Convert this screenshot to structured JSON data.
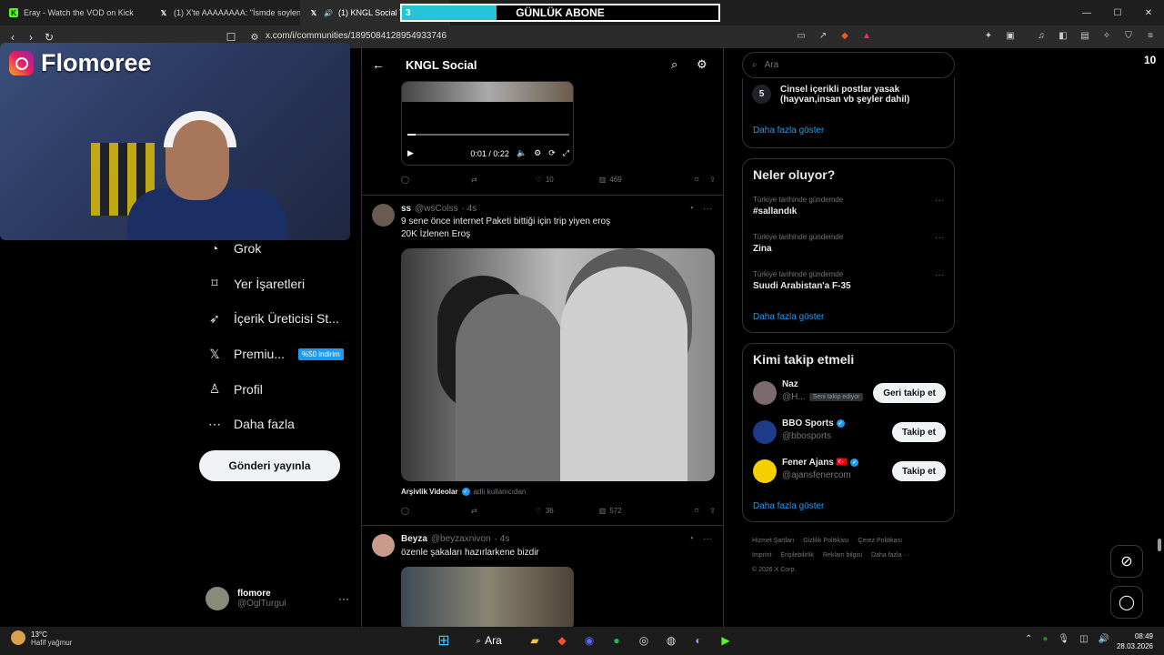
{
  "browser": {
    "tabs": [
      {
        "label": "Eray - Watch the VOD on Kick",
        "icon": "kick-icon",
        "color": "#53fc18"
      },
      {
        "label": "(1) X'te AAAAAAAA: \"İsmde soylendi",
        "icon": "x-icon",
        "color": "#ffffff"
      },
      {
        "label": "(1) KNGL Social Topluluğu",
        "icon": "x-icon",
        "color": "#ffffff"
      }
    ],
    "url": "x.com/i/communities/1895084128954933746"
  },
  "overlay": {
    "left": "3",
    "label": "GÜNLÜK ABONE",
    "right": "10",
    "progress": 0.3,
    "accent": "#25c5d6"
  },
  "webcam": {
    "brand": "Flomoree"
  },
  "left_nav": {
    "items": [
      {
        "label": "Grok",
        "icon": "grok-icon"
      },
      {
        "label": "Yer İşaretleri",
        "icon": "bookmark-icon"
      },
      {
        "label": "İçerik Üreticisi St...",
        "icon": "rocket-icon"
      },
      {
        "label": "Premiu...",
        "icon": "x-logo-icon",
        "badge": "%50 indirim"
      },
      {
        "label": "Profil",
        "icon": "person-icon"
      },
      {
        "label": "Daha fazla",
        "icon": "more-circle-icon"
      }
    ],
    "post_button": "Gönderi yayınla",
    "account": {
      "name": "flomore",
      "handle": "@OglTurgul"
    }
  },
  "header": {
    "title": "KNGL Social"
  },
  "video": {
    "time": "0:01 / 0:22",
    "progress": 0.05
  },
  "tweet1_actions": {
    "replies": "",
    "retweets": "",
    "likes": "10",
    "views": "469"
  },
  "tweet2": {
    "name": "ss",
    "handle": "@wsColss",
    "time": "· 4s",
    "line1": "9 sene önce internet Paketi bittiği için trip yiyen eroş",
    "line2": "20K İzlenen Eroş",
    "source_name": "Arşivlik Videolar",
    "source_suffix": "adlı kullanıcıdan",
    "likes": "36",
    "views": "572"
  },
  "tweet3": {
    "name": "Beyza",
    "handle": "@beyzaxnivon",
    "time": "· 4s",
    "text": "özenle şakaları hazırlarkene bizdir"
  },
  "right": {
    "search_placeholder": "Ara",
    "rule_num": "5",
    "rule_text_1": "Cinsel içerikli postlar yasak",
    "rule_text_2": "(hayvan,insan vb şeyler dahil)",
    "show_more": "Daha fazla göster",
    "trends_title": "Neler oluyor?",
    "trends": [
      {
        "context": "Türkiye tarihinde gündemde",
        "topic": "#sallandık"
      },
      {
        "context": "Türkiye tarihinde gündemde",
        "topic": "Zina"
      },
      {
        "context": "Türkiye tarihinde gündemde",
        "topic": "Suudi Arabistan'a F-35"
      }
    ],
    "follow_title": "Kimi takip etmeli",
    "follow": [
      {
        "name": "Naz",
        "handle": "@H...",
        "tag": "Seni takip ediyor",
        "button": "Geri takip et",
        "color": "#7d6b6b"
      },
      {
        "name": "BBO Sports",
        "handle": "@bbosports",
        "tag": "",
        "button": "Takip et",
        "color": "#1e3a8a"
      },
      {
        "name": "Fener Ajans 🇹🇷",
        "handle": "@ajansfenercom",
        "tag": "",
        "button": "Takip et",
        "color": "#f4d000"
      }
    ],
    "footer": [
      "Hizmet Şartları",
      "Gizlilik Politikası",
      "Çerez Politikası",
      "Imprint",
      "Erişilebilirlik",
      "Reklam bilgisi",
      "Daha fazla ···",
      "© 2026 X Corp."
    ]
  },
  "taskbar": {
    "temp": "13°C",
    "weather": "Hafif yağmur",
    "search": "Ara",
    "time": "08:49",
    "date": "28.03.2026"
  }
}
